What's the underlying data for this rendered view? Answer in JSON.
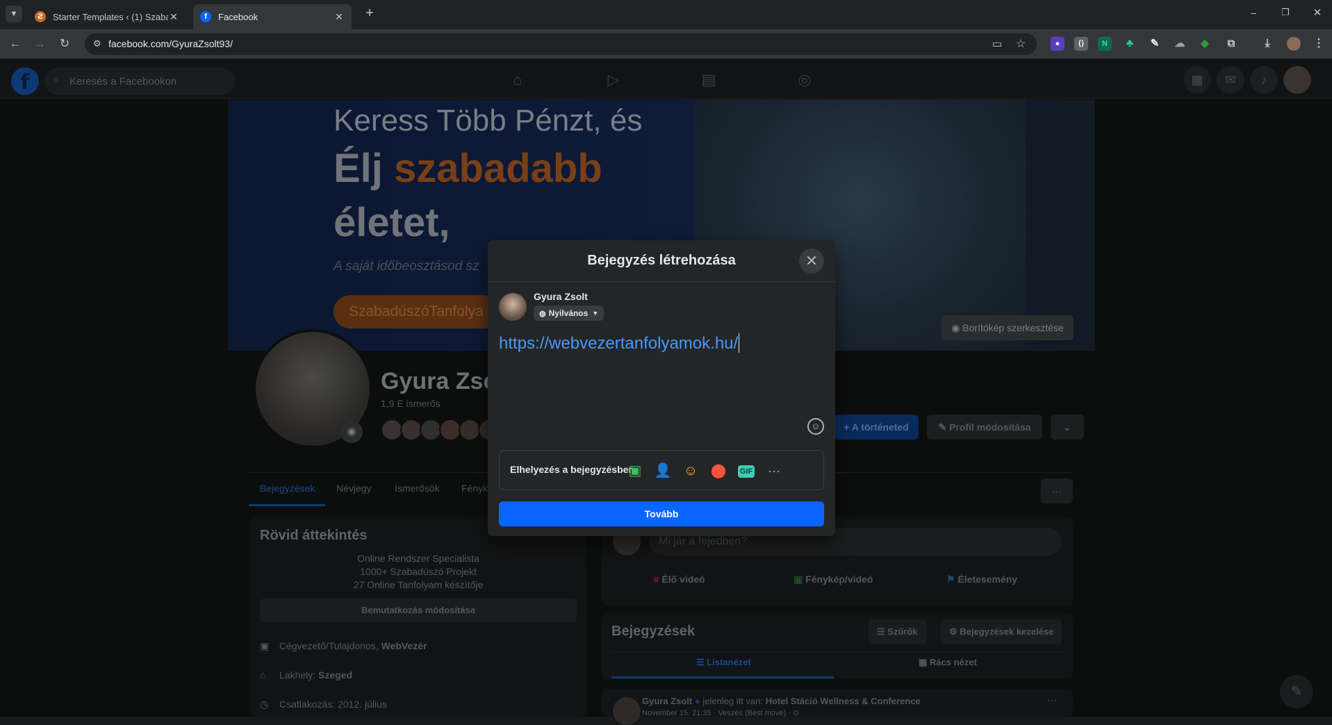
{
  "browser": {
    "tabs": [
      {
        "title": "Starter Templates ‹ (1) Szabadú",
        "active": false
      },
      {
        "title": "Facebook",
        "active": true
      }
    ],
    "new_tab": "+",
    "url": "facebook.com/GyuraZsolt93/",
    "window_controls": {
      "minimize": "–",
      "restore": "❐",
      "close": "✕"
    }
  },
  "fb_nav": {
    "search_placeholder": "Keresés a Facebookon"
  },
  "cover": {
    "line1": "Keress Több Pénzt, és",
    "line2_a": "Élj ",
    "line2_b": "szabadabb",
    "line3": "életet,",
    "line4": "A saját időbeosztásod sz",
    "cta": "SzabadúszóTanfolya",
    "edit_button": "Borítókép szerkesztése"
  },
  "profile": {
    "name": "Gyura Zsol",
    "friends": "1,9 E ismerős",
    "story_button": "A történeted",
    "edit_profile_button": "Profil módosítása",
    "tabs": [
      "Bejegyzések",
      "Névjegy",
      "Ismerősök",
      "Fényk"
    ],
    "more": "···"
  },
  "intro": {
    "title": "Rövid áttekintés",
    "bio": [
      "Online Rendszer Specialista",
      "1000+ Szabadúszó Projekt",
      "27 Online Tanfolyam készítője"
    ],
    "edit_bio": "Bemutatkozás módosítása",
    "work_prefix": "Cégvezető/Tulajdonos, ",
    "work_company": "WebVezér",
    "lives_prefix": "Lakhely: ",
    "lives_city": "Szeged",
    "joined": "Csatlakozás: 2012. július"
  },
  "composer": {
    "placeholder": "Mi jár a fejedben?",
    "live": "Élő videó",
    "photo": "Fénykép/videó",
    "life_event": "Életesemény"
  },
  "posts": {
    "title": "Bejegyzések",
    "filters": "Szűrők",
    "manage": "Bejegyzések kezelése",
    "list_view": "Listanézet",
    "grid_view": "Rács nézet",
    "first_author": "Gyura Zsolt",
    "first_action": " jelenleg itt van: ",
    "first_place": "Hotel Stáció Wellness & Conference",
    "first_meta": "November 15. 21:35 · Veszés (Best move) · ⊙"
  },
  "modal": {
    "title": "Bejegyzés létrehozása",
    "user": "Gyura Zsolt",
    "audience": "Nyilvános",
    "text": "https://webvezertanfolyamok.hu/",
    "add_to_post": "Elhelyezés a bejegyzésben",
    "icons": [
      "photo-video-icon",
      "tag-people-icon",
      "feeling-icon",
      "check-in-icon",
      "gif-icon",
      "more-icon"
    ],
    "submit": "Tovább",
    "gif_label": "GIF"
  },
  "colors": {
    "primary": "#0866ff",
    "link": "#4599ff",
    "modal_bg": "#242526"
  }
}
